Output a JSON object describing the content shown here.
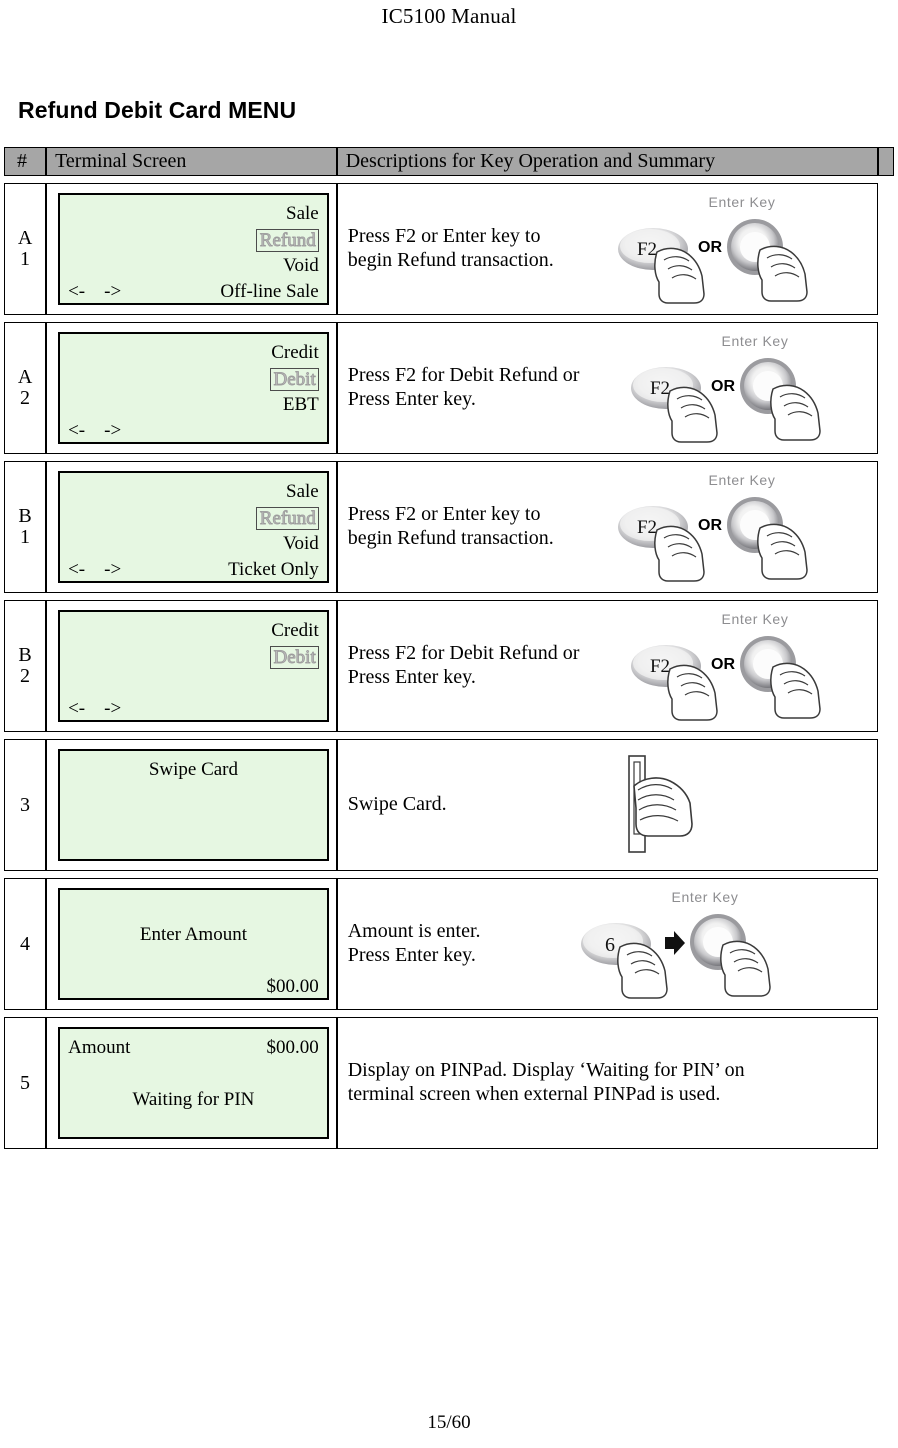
{
  "page": {
    "header_title": "IC5100 Manual",
    "section_title": "Refund Debit Card MENU",
    "footer": "15/60"
  },
  "table": {
    "columns": {
      "num": "#",
      "screen": "Terminal Screen",
      "description": "Descriptions for Key Operation and Summary",
      "tail": ""
    },
    "rows": [
      {
        "id": "A1",
        "num_line1": "A",
        "num_line2": "1",
        "screen": {
          "lines": [
            {
              "align": "right",
              "text": "Sale"
            },
            {
              "align": "right",
              "text": "Refund",
              "selected": true
            },
            {
              "align": "right",
              "text": "Void"
            },
            {
              "align": "spread",
              "left": "<-    ->",
              "right": "Off-line Sale"
            }
          ]
        },
        "description": "Press F2 or Enter key to\nbegin Refund transaction.",
        "art": "f2-or-enter-key"
      },
      {
        "id": "A2",
        "num_line1": "A",
        "num_line2": "2",
        "screen": {
          "lines": [
            {
              "align": "right",
              "text": "Credit"
            },
            {
              "align": "right",
              "text": "Debit",
              "selected": true
            },
            {
              "align": "right",
              "text": "EBT"
            },
            {
              "align": "left",
              "text": "<-    ->"
            }
          ]
        },
        "description": "Press F2 for Debit Refund or\nPress Enter key.",
        "art": "f2-or-enter-key"
      },
      {
        "id": "B1",
        "num_line1": "B",
        "num_line2": "1",
        "screen": {
          "lines": [
            {
              "align": "right",
              "text": "Sale"
            },
            {
              "align": "right",
              "text": "Refund",
              "selected": true
            },
            {
              "align": "right",
              "text": "Void"
            },
            {
              "align": "spread",
              "left": "<-    ->",
              "right": "Ticket Only"
            }
          ]
        },
        "description": "Press F2 or Enter key to\nbegin Refund transaction.",
        "art": "f2-or-enter-key"
      },
      {
        "id": "B2",
        "num_line1": "B",
        "num_line2": "2",
        "screen": {
          "lines": [
            {
              "align": "right",
              "text": "Credit"
            },
            {
              "align": "right",
              "text": "Debit",
              "selected": true
            },
            {
              "align": "right",
              "text": ""
            },
            {
              "align": "left",
              "text": "<-    ->"
            }
          ]
        },
        "description": "Press F2 for Debit Refund or\nPress Enter key.",
        "art": "f2-or-enter-key"
      },
      {
        "id": "3",
        "num_line1": "3",
        "num_line2": "",
        "screen": {
          "lines": [
            {
              "align": "center",
              "text": "Swipe Card"
            },
            {
              "align": "center",
              "text": ""
            },
            {
              "align": "center",
              "text": ""
            },
            {
              "align": "center",
              "text": ""
            }
          ]
        },
        "description": "Swipe Card.",
        "art": "swipe-card-hand"
      },
      {
        "id": "4",
        "num_line1": "4",
        "num_line2": "",
        "screen": {
          "lines": [
            {
              "align": "center",
              "text": ""
            },
            {
              "align": "center",
              "text": "Enter Amount"
            },
            {
              "align": "center",
              "text": ""
            },
            {
              "align": "right",
              "text": "$00.00"
            }
          ]
        },
        "description": "Amount is enter.\nPress Enter key.",
        "art": "six-then-enter-key"
      },
      {
        "id": "5",
        "num_line1": "5",
        "num_line2": "",
        "screen": {
          "lines": [
            {
              "align": "spread",
              "left": "Amount",
              "right": "$00.00"
            },
            {
              "align": "center",
              "text": ""
            },
            {
              "align": "center",
              "text": "Waiting for PIN"
            },
            {
              "align": "center",
              "text": ""
            }
          ]
        },
        "description": "Display on PINPad.  Display ‘Waiting for PIN’ on\nterminal screen when external PINPad is used.",
        "art": "none"
      }
    ]
  },
  "art_labels": {
    "f2_key": "F2",
    "or_text": "OR",
    "enter_key": "Enter Key",
    "six_key": "6"
  },
  "colors": {
    "lcd_background": "#e6f7e2",
    "header_background": "#a6a6a6",
    "border": "#000000"
  }
}
